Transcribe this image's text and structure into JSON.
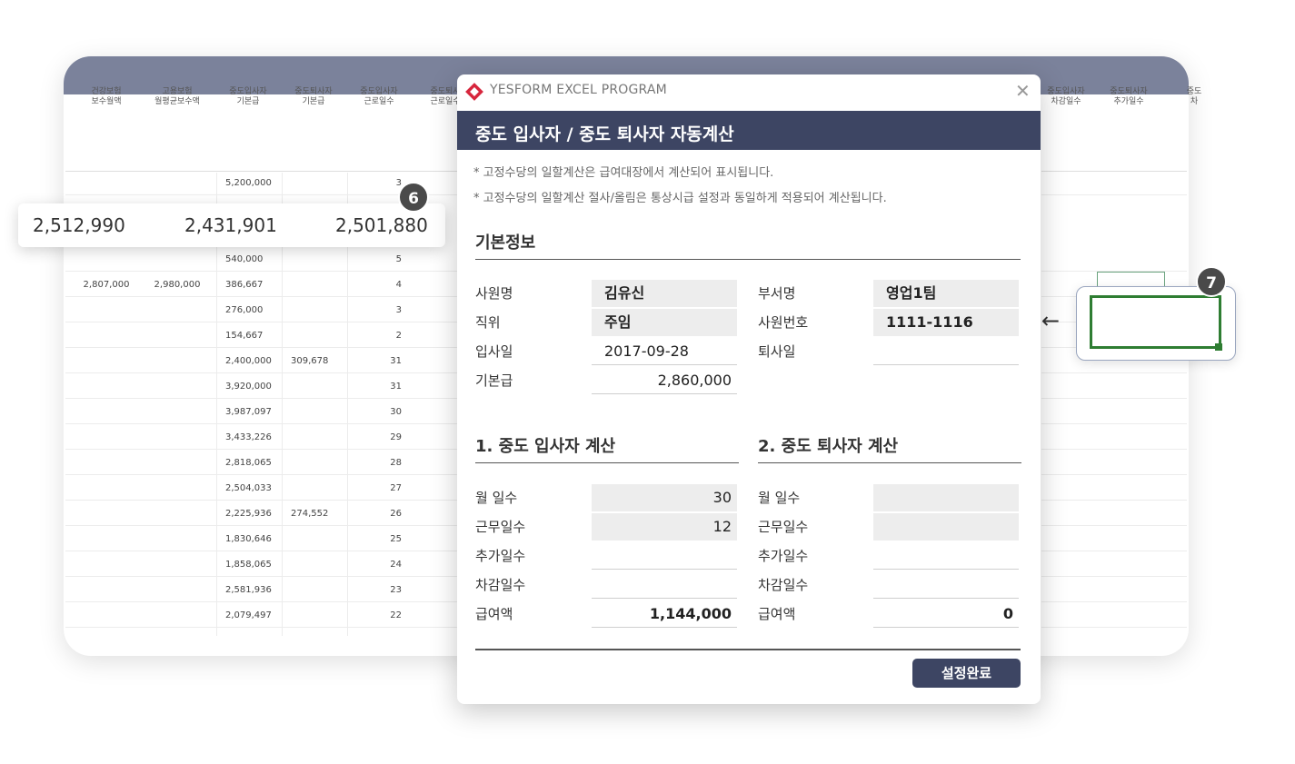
{
  "sheet": {
    "headers": [
      "건강보험\n보수월액",
      "고용보험\n월평균보수액",
      "중도입사자\n기본급",
      "중도퇴사자\n기본급",
      "중도입사자\n근로일수",
      "중도퇴사\n근로일수"
    ],
    "right_headers": [
      "중도입사자\n차감일수",
      "중도퇴사자\n추가일수",
      "중도\n차"
    ],
    "rows": [
      [
        "",
        "",
        "5,200,000",
        "",
        "3",
        ""
      ],
      [
        "",
        "",
        "540,000",
        "",
        "5",
        ""
      ],
      [
        "2,807,000",
        "2,980,000",
        "386,667",
        "",
        "4",
        ""
      ],
      [
        "",
        "",
        "276,000",
        "",
        "3",
        ""
      ],
      [
        "",
        "",
        "154,667",
        "",
        "2",
        ""
      ],
      [
        "",
        "",
        "2,400,000",
        "309,678",
        "31",
        ""
      ],
      [
        "",
        "",
        "3,920,000",
        "",
        "31",
        ""
      ],
      [
        "",
        "",
        "3,987,097",
        "",
        "30",
        ""
      ],
      [
        "",
        "",
        "3,433,226",
        "",
        "29",
        ""
      ],
      [
        "",
        "",
        "2,818,065",
        "",
        "28",
        ""
      ],
      [
        "",
        "",
        "2,504,033",
        "",
        "27",
        ""
      ],
      [
        "",
        "",
        "2,225,936",
        "274,552",
        "26",
        ""
      ],
      [
        "",
        "",
        "1,830,646",
        "",
        "25",
        ""
      ],
      [
        "",
        "",
        "1,858,065",
        "",
        "24",
        ""
      ],
      [
        "",
        "",
        "2,581,936",
        "",
        "23",
        ""
      ],
      [
        "",
        "",
        "2,079,497",
        "",
        "22",
        ""
      ]
    ],
    "strip_values": [
      "2,512,990",
      "2,431,901",
      "2,501,880"
    ],
    "badge_6": "6",
    "badge_7": "7",
    "arrow": "←"
  },
  "dialog": {
    "app_title": "YESFORM EXCEL PROGRAM",
    "close": "✕",
    "header": "중도 입사자 / 중도 퇴사자 자동계산",
    "notes": [
      "* 고정수당의 일할계산은 급여대장에서 계산되어 표시됩니다.",
      "* 고정수당의 일할계산 절사/올림은 통상시급 설정과 동일하게 적용되어 계산됩니다."
    ],
    "basic_info": {
      "title": "기본정보",
      "name_label": "사원명",
      "name_value": "김유신",
      "dept_label": "부서명",
      "dept_value": "영업1팀",
      "position_label": "직위",
      "position_value": "주임",
      "emp_no_label": "사원번호",
      "emp_no_value": "1111-1116",
      "join_label": "입사일",
      "join_value": "2017-09-28",
      "leave_label": "퇴사일",
      "leave_value": "",
      "salary_label": "기본급",
      "salary_value": "2,860,000"
    },
    "section1": {
      "title": "1. 중도 입사자 계산",
      "month_days_label": "월 일수",
      "month_days_value": "30",
      "work_days_label": "근무일수",
      "work_days_value": "12",
      "add_days_label": "추가일수",
      "add_days_value": "",
      "deduct_days_label": "차감일수",
      "deduct_days_value": "",
      "pay_label": "급여액",
      "pay_value": "1,144,000"
    },
    "section2": {
      "title": "2. 중도 퇴사자 계산",
      "month_days_label": "월 일수",
      "month_days_value": "",
      "work_days_label": "근무일수",
      "work_days_value": "",
      "add_days_label": "추가일수",
      "add_days_value": "",
      "deduct_days_label": "차감일수",
      "deduct_days_value": "",
      "pay_label": "급여액",
      "pay_value": "0"
    },
    "done_button": "설정완료"
  },
  "colors": {
    "header_navy": "#3d4563",
    "band": "#7b829b",
    "accent_green": "#2e7d32"
  }
}
